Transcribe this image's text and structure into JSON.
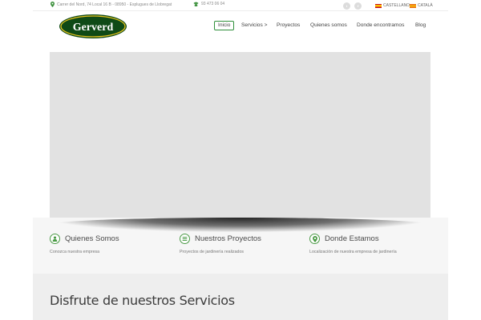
{
  "topbar": {
    "address": "Carrer del Nord, 74 Local 16 B - 08950 - Esplugues de Llobregat",
    "phone": "93 473 06 04",
    "languages": [
      {
        "label": "CASTELLANO",
        "flag": "es"
      },
      {
        "label": "CATALÀ",
        "flag": "ca"
      }
    ],
    "social": [
      {
        "icon": "twitter-icon",
        "glyph": "t"
      },
      {
        "icon": "facebook-icon",
        "glyph": "f"
      }
    ]
  },
  "header": {
    "logo_text": "Gerverd",
    "nav": [
      {
        "label": "Inicio",
        "active": true
      },
      {
        "label": "Servicios >",
        "active": false
      },
      {
        "label": "Proyectos",
        "active": false
      },
      {
        "label": "Quienes somos",
        "active": false
      },
      {
        "label": "Donde encontramos",
        "active": false
      },
      {
        "label": "Blog",
        "active": false
      }
    ]
  },
  "features": [
    {
      "title": "Quienes Somos",
      "subtitle": "Conozca nuestra empresa",
      "icon": "user-icon"
    },
    {
      "title": "Nuestros Proyectos",
      "subtitle": "Proyectos de jardinería realizados",
      "icon": "list-icon"
    },
    {
      "title": "Donde Estamos",
      "subtitle": "Localización de nuestra empresa de jardinería",
      "icon": "location-icon"
    }
  ],
  "services": {
    "title": "Disfrute de nuestros Servicios"
  },
  "colors": {
    "brand_green": "#2f8f3a",
    "logo_dark_green": "#0f4a16",
    "logo_yellow": "#e6c21f",
    "slider_bg": "#e2e2e2"
  }
}
